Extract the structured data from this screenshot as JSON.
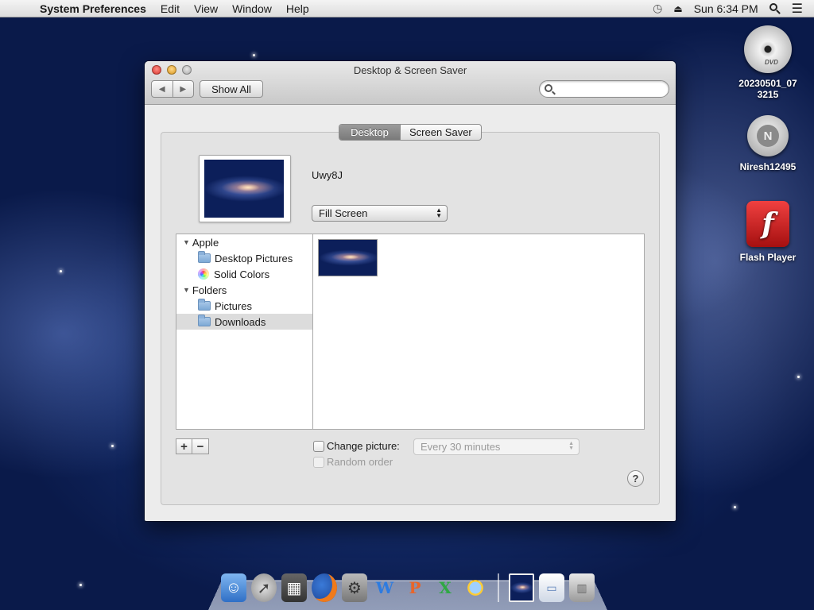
{
  "menubar": {
    "app_name": "System Preferences",
    "menus": [
      "Edit",
      "View",
      "Window",
      "Help"
    ],
    "clock": "Sun 6:34 PM"
  },
  "window": {
    "title": "Desktop & Screen Saver",
    "show_all_label": "Show All",
    "search_placeholder": ""
  },
  "tabs": [
    "Desktop",
    "Screen Saver"
  ],
  "current_wallpaper": {
    "name": "Uwy8J",
    "fit_mode": "Fill Screen"
  },
  "sources": {
    "groups": [
      {
        "label": "Apple",
        "items": [
          "Desktop Pictures",
          "Solid Colors"
        ]
      },
      {
        "label": "Folders",
        "items": [
          "Pictures",
          "Downloads"
        ]
      }
    ],
    "selected": "Downloads"
  },
  "options": {
    "change_picture_label": "Change picture:",
    "change_picture_interval": "Every 30 minutes",
    "random_order_label": "Random order",
    "add_symbol": "+",
    "remove_symbol": "−",
    "help_symbol": "?"
  },
  "desktop_icons": [
    {
      "label": "20230501_07 3215",
      "icon": "dvd-icon",
      "badge": "DVD"
    },
    {
      "label": "Niresh12495",
      "icon": "drive-icon",
      "badge": "N"
    },
    {
      "label": "Flash Player",
      "icon": "flash-player-icon",
      "badge": "f"
    }
  ],
  "colors": {
    "selection_row": "#dcdcdc",
    "active_tab": "#8a8a8a",
    "close": "#e0443e",
    "minimize": "#e1a525",
    "zoom": "#b8b8b8"
  }
}
